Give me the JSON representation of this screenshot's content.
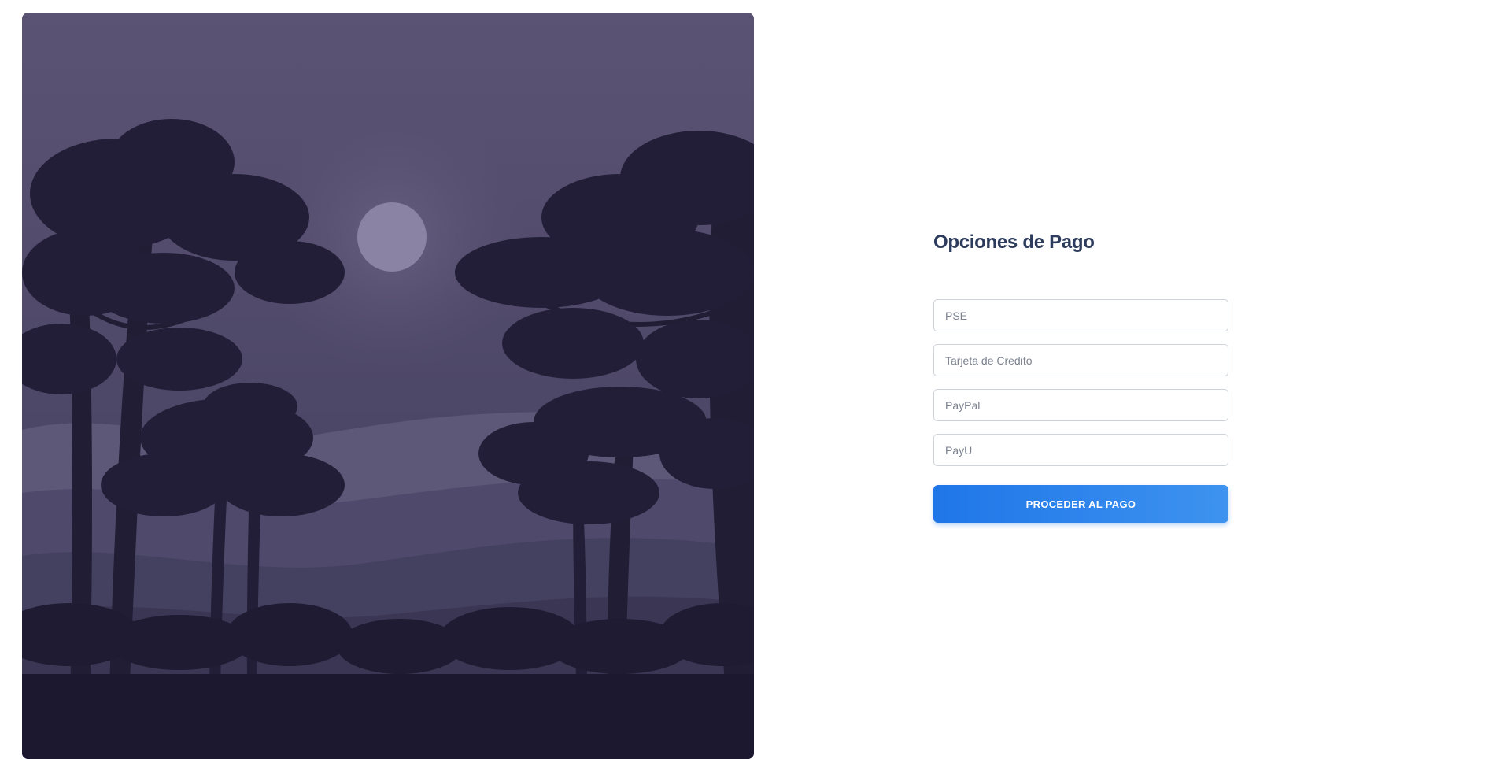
{
  "hero": {
    "illustration": "night-forest-moon-illustration",
    "colors": {
      "sky_top": "#5b5373",
      "sky_bottom": "#4a4463",
      "moon": "#8a83a3",
      "far_hills": "#5d5878",
      "mid_hills": "#3b3653",
      "trees": "#201c33",
      "ground": "#1b1830"
    }
  },
  "payment": {
    "title": "Opciones de Pago",
    "options": [
      {
        "placeholder": "PSE",
        "value": ""
      },
      {
        "placeholder": "Tarjeta de Credito",
        "value": ""
      },
      {
        "placeholder": "PayPal",
        "value": ""
      },
      {
        "placeholder": "PayU",
        "value": ""
      }
    ],
    "submit_label": "PROCEDER AL PAGO"
  },
  "colors": {
    "title": "#2d3b5c",
    "button_start": "#1f76e8",
    "button_end": "#3e93ef",
    "field_border": "#cfd3da"
  }
}
